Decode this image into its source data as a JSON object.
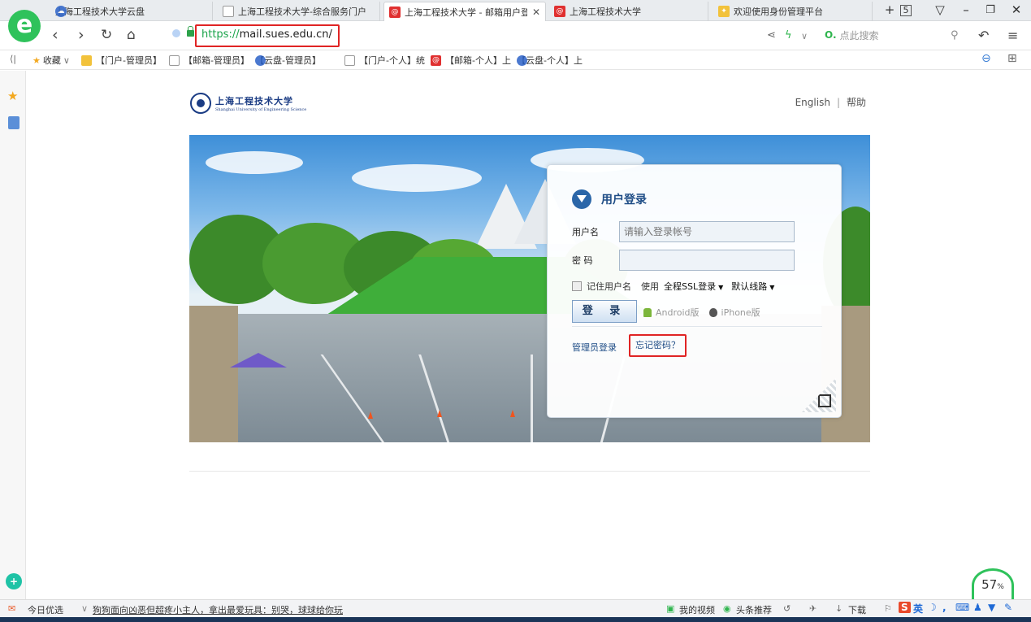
{
  "browser": {
    "tabs": [
      {
        "label": "上海工程技术大学云盘",
        "icon": "cloud-disk-icon"
      },
      {
        "label": "上海工程技术大学-综合服务门户",
        "icon": "document-icon"
      },
      {
        "label": "上海工程技术大学 - 邮箱用户登录",
        "icon": "mail-icon",
        "active": true
      },
      {
        "label": "上海工程技术大学",
        "icon": "mail-icon"
      },
      {
        "label": "欢迎使用身份管理平台",
        "icon": "identity-icon"
      }
    ],
    "tab_count": "5",
    "url_scheme": "https://",
    "url_rest": "mail.sues.edu.cn/",
    "search_placeholder": "点此搜索",
    "bookmarks": [
      {
        "label": "收藏",
        "icon": "star-icon"
      },
      {
        "label": "【门户-管理员】",
        "icon": "identity-icon"
      },
      {
        "label": "【邮箱-管理员】",
        "icon": "document-icon"
      },
      {
        "label": "【云盘-管理员】",
        "icon": "cloud-disk-icon"
      },
      {
        "label": "【门户-个人】统",
        "icon": "document-icon"
      },
      {
        "label": "【邮箱-个人】上",
        "icon": "mail-icon"
      },
      {
        "label": "【云盘-个人】上",
        "icon": "cloud-disk-icon"
      }
    ]
  },
  "page": {
    "school_name_cn": "上海工程技术大学",
    "school_name_en": "Shanghai University of Engineering Science",
    "link_english": "English",
    "link_sep": "|",
    "link_help": "帮助",
    "login": {
      "title": "用户登录",
      "username_label": "用户名",
      "username_placeholder": "请输入登录帐号",
      "password_label": "密 码",
      "remember_label": "记住用户名",
      "use_label": "使用",
      "ssl_option": "全程SSL登录",
      "route_option": "默认线路",
      "login_button": "登 录",
      "android_link": "Android版",
      "iphone_link": "iPhone版",
      "admin_link": "管理员登录",
      "forgot_link": "忘记密码？"
    }
  },
  "status": {
    "today_pick": "今日优选",
    "news": "狗狗面向凶恶但超疼小主人，拿出最爱玩具：别哭，球球给你玩",
    "video": "我的视频",
    "headline": "头条推荐",
    "download": "下载",
    "ime_lang": "英",
    "memory_percent": "57",
    "memory_unit": "%"
  },
  "colors": {
    "accent": "#1f4d86",
    "highlight_box": "#e02424",
    "browser_green": "#2fc25b"
  }
}
